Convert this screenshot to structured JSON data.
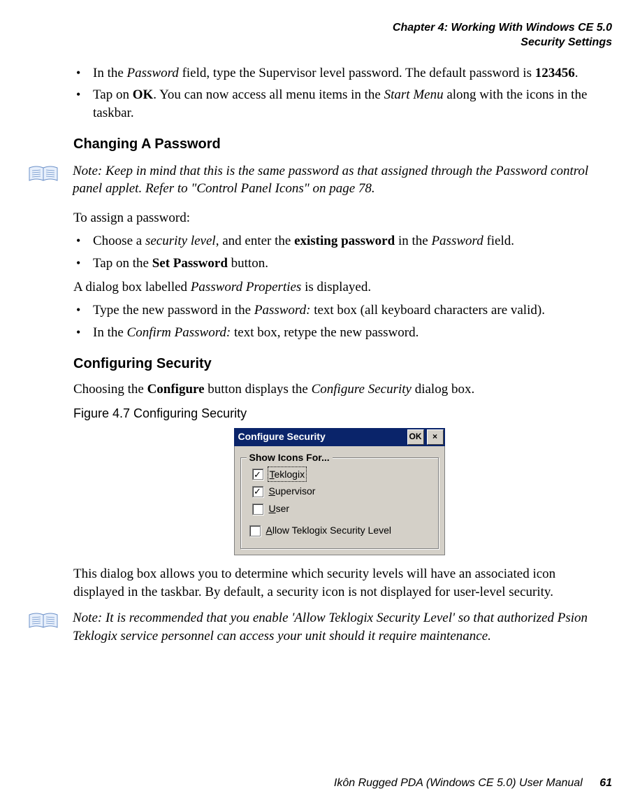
{
  "header": {
    "line1": "Chapter 4: Working With Windows CE 5.0",
    "line2": "Security Settings"
  },
  "top_bullets": [
    {
      "pre": "In the ",
      "i1": "Password",
      "mid": " field, type the Supervisor level password. The default password is ",
      "b1": "123456",
      "post": "."
    },
    {
      "pre": "Tap on ",
      "b1": "OK",
      "mid": ". You can now access all menu items in the ",
      "i1": "Start Menu",
      "post": " along with the icons in the taskbar."
    }
  ],
  "section1_title": "Changing A Password",
  "note1": {
    "label": "Note:",
    "text": " Keep in mind that this is the same password as that assigned through the Password control panel applet. Refer to \"Control Panel Icons\" on page 78."
  },
  "para_assign": "To assign a password:",
  "assign_bullets": [
    {
      "pre": "Choose a ",
      "i1": "security level",
      "mid": ", and enter the ",
      "b1": "existing password",
      "mid2": " in the ",
      "i2": "Password",
      "post": " field."
    },
    {
      "pre": "Tap on the ",
      "b1": "Set Password",
      "post": " button."
    }
  ],
  "para_dialog": {
    "pre": "A dialog box labelled ",
    "i1": "Password Properties",
    "post": " is displayed."
  },
  "dialog_bullets": [
    {
      "pre": "Type the new password in the ",
      "i1": "Password:",
      "post": " text box (all keyboard characters are valid)."
    },
    {
      "pre": "In the ",
      "i1": "Confirm Password:",
      "post": " text box, retype the new password."
    }
  ],
  "section2_title": "Configuring Security",
  "para_configure": {
    "pre": "Choosing the ",
    "b1": "Configure",
    "mid": " button displays the ",
    "i1": "Configure Security",
    "post": " dialog box."
  },
  "figure_caption": "Figure 4.7  Configuring Security",
  "dialog": {
    "title": "Configure Security",
    "ok": "OK",
    "close": "×",
    "group_title": "Show Icons For...",
    "opt_teklogix": "Teklogix",
    "opt_supervisor": "Supervisor",
    "opt_user": "User",
    "opt_allow": "Allow Teklogix Security Level",
    "check_mark": "✓"
  },
  "para_after_dialog": "This dialog box allows you to determine which security levels will have an associated icon displayed in the taskbar. By default, a security icon is not displayed for user-level security.",
  "note2": {
    "label": "Note:",
    "text": " It is recommended that you enable 'Allow Teklogix Security Level' so that authorized Psion Teklogix service personnel can access your unit should it require maintenance."
  },
  "footer": {
    "text": "Ikôn Rugged PDA (Windows CE 5.0) User Manual",
    "page": "61"
  }
}
